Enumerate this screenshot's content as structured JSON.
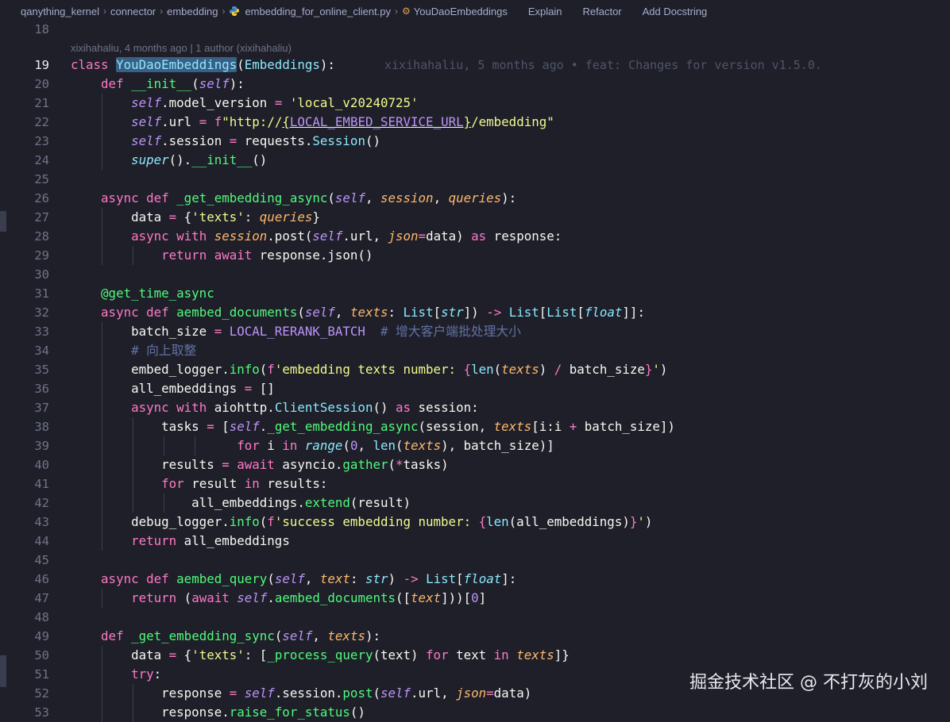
{
  "breadcrumb": {
    "items": [
      "qanything_kernel",
      "connector",
      "embedding",
      "embedding_for_online_client.py",
      "YouDaoEmbeddings"
    ],
    "separator": "›",
    "file_icon": "python-icon",
    "class_icon": "class-symbol-icon",
    "lens_actions": [
      "Explain",
      "Refactor",
      "Add Docstring"
    ]
  },
  "blame": {
    "header": "xixihahaliu, 4 months ago | 1 author (xixihahaliu)",
    "inline": "xixihahaliu, 5 months ago • feat: Changes for version v1.5.0."
  },
  "editor": {
    "active_line": "19",
    "line_numbers": [
      "18",
      "19",
      "20",
      "21",
      "22",
      "23",
      "24",
      "25",
      "26",
      "27",
      "28",
      "29",
      "30",
      "31",
      "32",
      "33",
      "34",
      "35",
      "36",
      "37",
      "38",
      "39",
      "40",
      "41",
      "42",
      "43",
      "44",
      "45",
      "46",
      "47",
      "48",
      "49",
      "50",
      "51",
      "52",
      "53"
    ]
  },
  "code": {
    "class_name": "YouDaoEmbeddings",
    "base_class": "Embeddings",
    "model_version": "'local_v20240725'",
    "url_prefix": "\"http://",
    "url_const": "LOCAL_EMBED_SERVICE_URL",
    "url_suffix": "/embedding\"",
    "comment_batch": "# 增大客户端批处理大小",
    "comment_ceil": "# 向上取整",
    "log_msg_1": "'embedding texts number: ",
    "log_msg_2": "'success embedding number: ",
    "decorator": "@get_time_async",
    "texts_key": "'texts'"
  },
  "watermark": "掘金技术社区 @ 不打灰的小刘",
  "colors": {
    "background": "#1e1f29",
    "keyword": "#ff79c6",
    "function": "#50fa7b",
    "class": "#8be9fd",
    "string": "#f1fa8c",
    "parameter": "#ffb86c",
    "self": "#bd93f9",
    "comment": "#6272a4"
  }
}
